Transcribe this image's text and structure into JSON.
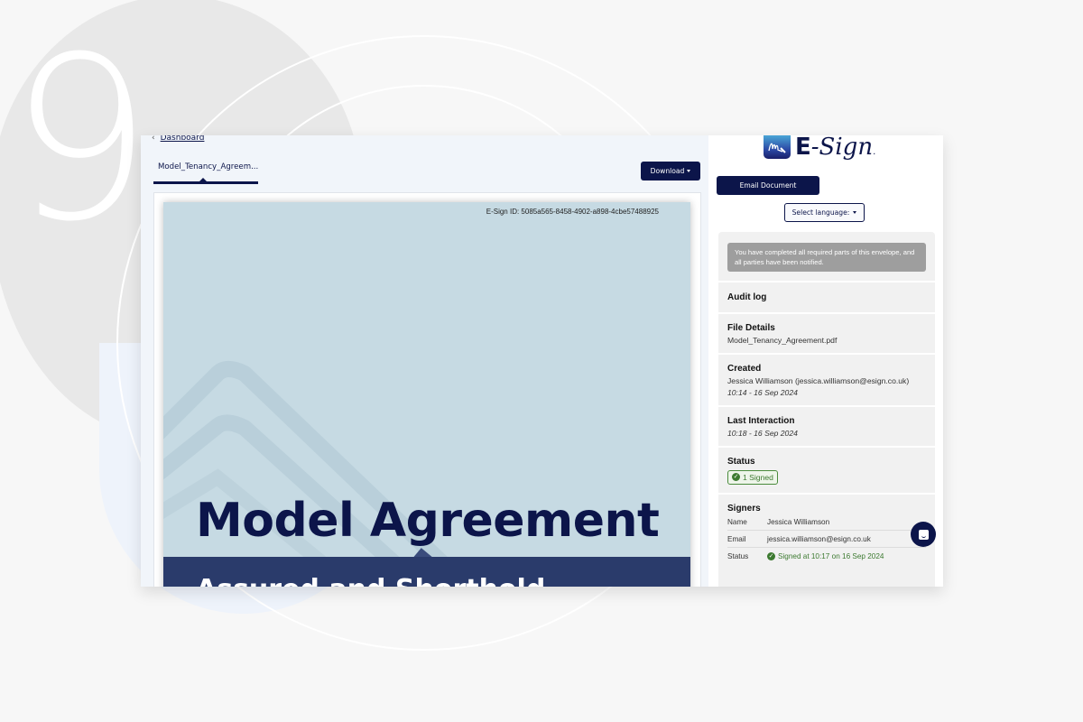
{
  "decor": {
    "step_number": "9"
  },
  "nav": {
    "back_label": "Dashboard",
    "back_icon": "chevron-left-icon"
  },
  "tabs": [
    {
      "label": "Model_Tenancy_Agreem...",
      "active": true
    }
  ],
  "toolbar": {
    "download_label": "Download"
  },
  "document": {
    "esign_id": "E-Sign ID: 5085a565-8458-4902-a898-4cbe57488925",
    "title": "Model Agreement",
    "subtitle": "Assured and Shorthold"
  },
  "brand": {
    "name_prefix": "E",
    "name_suffix": "-Sign",
    "trademark": ".",
    "colors": {
      "primary": "#0c154a",
      "success": "#3c7a30"
    }
  },
  "actions": {
    "email_label": "Email Document",
    "language_label": "Select language:"
  },
  "details": {
    "notice": "You have completed all required parts of this envelope, and all parties have been notified.",
    "audit_log_label": "Audit log",
    "file_details": {
      "heading": "File Details",
      "value": "Model_Tenancy_Agreement.pdf"
    },
    "created": {
      "heading": "Created",
      "by": "Jessica Williamson (jessica.williamson@esign.co.uk)",
      "time": "10:14 - 16 Sep 2024"
    },
    "last_interaction": {
      "heading": "Last Interaction",
      "time": "10:18 - 16 Sep 2024"
    },
    "status": {
      "heading": "Status",
      "badge": "1 Signed"
    },
    "signers": {
      "heading": "Signers",
      "rows": [
        {
          "key": "Name",
          "value": "Jessica Williamson"
        },
        {
          "key": "Email",
          "value": "jessica.williamson@esign.co.uk"
        },
        {
          "key": "Status",
          "value": "Signed at 10:17 on 16 Sep 2024"
        }
      ]
    }
  }
}
